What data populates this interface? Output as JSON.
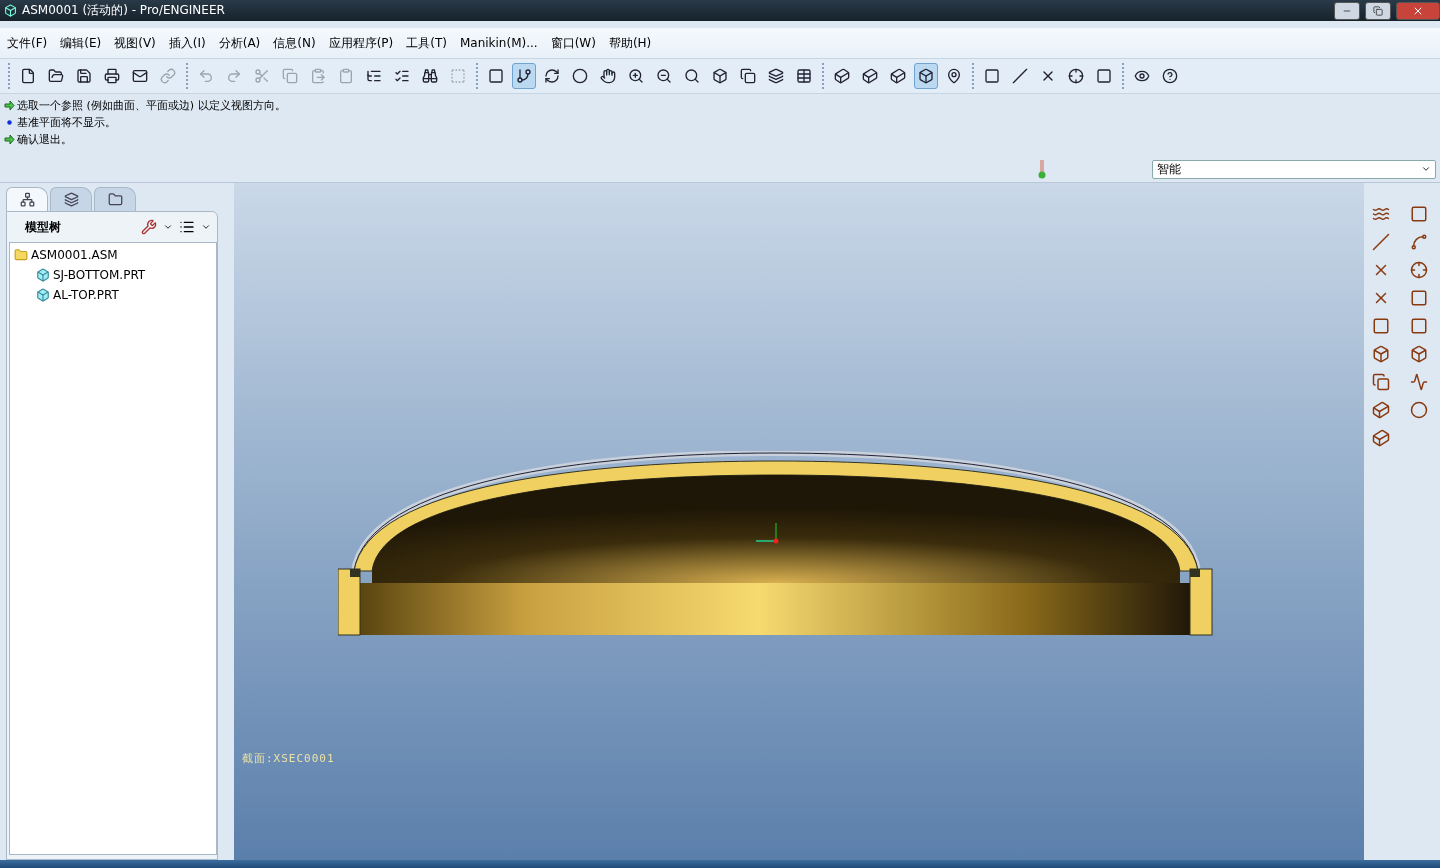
{
  "window": {
    "title": "ASM0001 (活动的) - Pro/ENGINEER"
  },
  "menu": [
    "文件(F)",
    "编辑(E)",
    "视图(V)",
    "插入(I)",
    "分析(A)",
    "信息(N)",
    "应用程序(P)",
    "工具(T)",
    "Manikin(M)...",
    "窗口(W)",
    "帮助(H)"
  ],
  "toolbar": {
    "groups": [
      [
        {
          "pressed": false,
          "disabled": false
        },
        {
          "pressed": false,
          "disabled": false
        },
        {
          "pressed": false,
          "disabled": false
        },
        {
          "pressed": false,
          "disabled": false
        },
        {
          "pressed": false,
          "disabled": false
        },
        {
          "pressed": false,
          "disabled": true
        }
      ],
      [
        {
          "pressed": false,
          "disabled": true
        },
        {
          "pressed": false,
          "disabled": true
        },
        {
          "pressed": false,
          "disabled": true
        },
        {
          "pressed": false,
          "disabled": true
        },
        {
          "pressed": false,
          "disabled": true
        },
        {
          "pressed": false,
          "disabled": true
        },
        {
          "pressed": false,
          "disabled": false
        },
        {
          "pressed": false,
          "disabled": false
        },
        {
          "pressed": false,
          "disabled": false
        },
        {
          "pressed": false,
          "disabled": true
        }
      ],
      [
        {
          "pressed": false,
          "disabled": false
        },
        {
          "pressed": true,
          "disabled": false
        },
        {
          "pressed": false,
          "disabled": false
        },
        {
          "pressed": false,
          "disabled": false
        },
        {
          "pressed": false,
          "disabled": false
        },
        {
          "pressed": false,
          "disabled": false
        },
        {
          "pressed": false,
          "disabled": false
        },
        {
          "pressed": false,
          "disabled": false
        },
        {
          "pressed": false,
          "disabled": false
        },
        {
          "pressed": false,
          "disabled": false
        },
        {
          "pressed": false,
          "disabled": false
        },
        {
          "pressed": false,
          "disabled": false
        }
      ],
      [
        {
          "pressed": false,
          "disabled": false
        },
        {
          "pressed": false,
          "disabled": false
        },
        {
          "pressed": false,
          "disabled": false
        },
        {
          "pressed": true,
          "disabled": false
        },
        {
          "pressed": false,
          "disabled": false
        }
      ],
      [
        {
          "pressed": false,
          "disabled": false
        },
        {
          "pressed": false,
          "disabled": false
        },
        {
          "pressed": false,
          "disabled": false
        },
        {
          "pressed": false,
          "disabled": false
        },
        {
          "pressed": false,
          "disabled": false
        }
      ],
      [
        {
          "pressed": false,
          "disabled": false
        },
        {
          "pressed": false,
          "disabled": false
        }
      ]
    ]
  },
  "messages": [
    {
      "kind": "prompt",
      "text": "选取一个参照 (例如曲面、平面或边) 以定义视图方向。"
    },
    {
      "kind": "info",
      "text": "基准平面将不显示。"
    },
    {
      "kind": "prompt",
      "text": "确认退出。"
    }
  ],
  "filter": {
    "value": "智能"
  },
  "navigator": {
    "tabs": [
      {
        "selected": true
      },
      {
        "selected": false
      },
      {
        "selected": false
      }
    ],
    "title": "模型树",
    "tree": [
      {
        "label": "ASM0001.ASM",
        "kind": "assembly",
        "children": [
          {
            "label": "SJ-BOTTOM.PRT",
            "kind": "part"
          },
          {
            "label": "AL-TOP.PRT",
            "kind": "part"
          }
        ]
      }
    ]
  },
  "viewport": {
    "section_label": "截面:XSEC0001"
  }
}
